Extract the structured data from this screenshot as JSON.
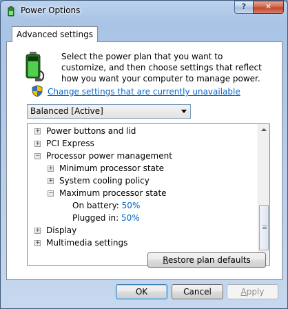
{
  "window": {
    "title": "Power Options"
  },
  "tabs": [
    {
      "label": "Advanced settings"
    }
  ],
  "description": "Select the power plan that you want to customize, and then choose settings that reflect how you want your computer to manage power.",
  "change_settings_link": "Change settings that are currently unavailable",
  "plan_select": {
    "value": "Balanced [Active]"
  },
  "tree": [
    {
      "label": "Power buttons and lid",
      "expander": "+"
    },
    {
      "label": "PCI Express",
      "expander": "+"
    },
    {
      "label": "Processor power management",
      "expander": "−"
    },
    {
      "label": "Minimum processor state",
      "expander": "+"
    },
    {
      "label": "System cooling policy",
      "expander": "+"
    },
    {
      "label": "Maximum processor state",
      "expander": "−"
    },
    {
      "label": "On battery:",
      "value": "50%"
    },
    {
      "label": "Plugged in:",
      "value": "50%"
    },
    {
      "label": "Display",
      "expander": "+"
    },
    {
      "label": "Multimedia settings",
      "expander": "+"
    }
  ],
  "buttons": {
    "restore_prefix": "R",
    "restore_rest": "estore plan defaults",
    "ok": "OK",
    "cancel": "Cancel",
    "apply_prefix": "A",
    "apply_rest": "pply"
  },
  "icons": {
    "title": "power-options-icon",
    "battery": "battery-plug-icon",
    "shield": "uac-shield-icon"
  }
}
